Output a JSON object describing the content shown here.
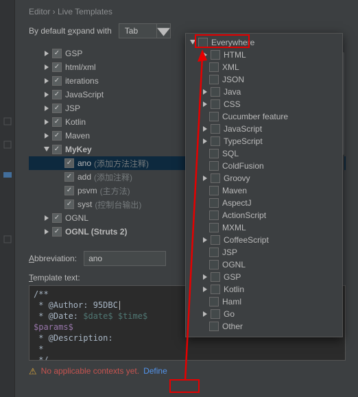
{
  "breadcrumb": "Editor › Live Templates",
  "expand_label_pre": "By default ",
  "expand_label_u": "e",
  "expand_label_post": "xpand with",
  "expand_value": "Tab",
  "tree": [
    {
      "label": "GSP",
      "checked": true,
      "exp": false,
      "depth": 1
    },
    {
      "label": "html/xml",
      "checked": true,
      "exp": false,
      "depth": 1
    },
    {
      "label": "iterations",
      "checked": true,
      "exp": false,
      "depth": 1
    },
    {
      "label": "JavaScript",
      "checked": true,
      "exp": false,
      "depth": 1
    },
    {
      "label": "JSP",
      "checked": true,
      "exp": false,
      "depth": 1
    },
    {
      "label": "Kotlin",
      "checked": true,
      "exp": false,
      "depth": 1
    },
    {
      "label": "Maven",
      "checked": true,
      "exp": false,
      "depth": 1
    },
    {
      "label": "MyKey",
      "checked": true,
      "exp": true,
      "depth": 1,
      "bold": true
    },
    {
      "label": "ano",
      "desc": "(添加方法注释)",
      "checked": true,
      "depth": 2,
      "sel": true
    },
    {
      "label": "add",
      "desc": "(添加注释)",
      "checked": true,
      "depth": 2
    },
    {
      "label": "psvm",
      "desc": "(主方法)",
      "checked": true,
      "depth": 2
    },
    {
      "label": "syst",
      "desc": "(控制台输出)",
      "checked": true,
      "depth": 2
    },
    {
      "label": "OGNL",
      "checked": true,
      "exp": false,
      "depth": 1
    },
    {
      "label": "OGNL (Struts 2)",
      "checked": true,
      "exp": false,
      "depth": 1,
      "bold": true
    }
  ],
  "abbr_label_pre": "",
  "abbr_label_u": "A",
  "abbr_label_post": "bbreviation:",
  "abbr_value": "ano",
  "tmpl_label_u": "T",
  "tmpl_label_post": "emplate text:",
  "code": {
    "l1": "/**",
    "l2": " * @Author: 95DBC",
    "l3_pre": " * @Date: ",
    "l3_v1": "$date$",
    "l3_mid": " ",
    "l3_v2": "$time$",
    "l4": "$params$",
    "l5": " * @Description:",
    "l6": " *",
    "l7": " */"
  },
  "footer_warn": "No applicable contexts yet.",
  "footer_link": "Define",
  "popup": {
    "root": "Everywhere",
    "items": [
      {
        "label": "HTML",
        "tri": true
      },
      {
        "label": "XML",
        "tri": false
      },
      {
        "label": "JSON",
        "tri": false
      },
      {
        "label": "Java",
        "tri": true
      },
      {
        "label": "CSS",
        "tri": true
      },
      {
        "label": "Cucumber feature",
        "tri": false
      },
      {
        "label": "JavaScript",
        "tri": true
      },
      {
        "label": "TypeScript",
        "tri": true
      },
      {
        "label": "SQL",
        "tri": false
      },
      {
        "label": "ColdFusion",
        "tri": false
      },
      {
        "label": "Groovy",
        "tri": true
      },
      {
        "label": "Maven",
        "tri": false
      },
      {
        "label": "AspectJ",
        "tri": false
      },
      {
        "label": "ActionScript",
        "tri": false
      },
      {
        "label": "MXML",
        "tri": false
      },
      {
        "label": "CoffeeScript",
        "tri": true
      },
      {
        "label": "JSP",
        "tri": false
      },
      {
        "label": "OGNL",
        "tri": false
      },
      {
        "label": "GSP",
        "tri": true
      },
      {
        "label": "Kotlin",
        "tri": true
      },
      {
        "label": "Haml",
        "tri": false
      },
      {
        "label": "Go",
        "tri": true
      },
      {
        "label": "Other",
        "tri": false
      }
    ]
  }
}
